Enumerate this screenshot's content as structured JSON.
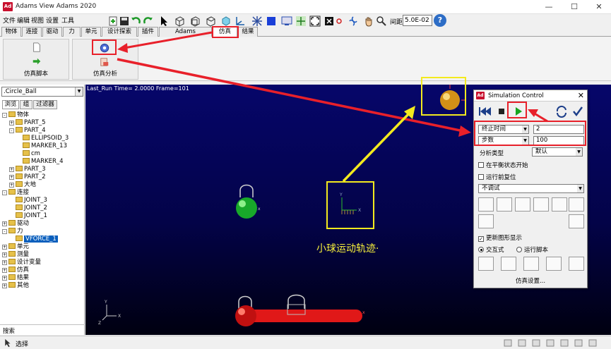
{
  "window": {
    "title": "Adams View Adams 2020",
    "minimize": "—",
    "maximize": "☐",
    "close": "✕"
  },
  "menu": [
    "文件",
    "编辑",
    "视图",
    "设置",
    "工具"
  ],
  "toolbar": {
    "zoom_label": "间距",
    "zoom_value": "5.0E-02",
    "help": "?"
  },
  "tabs": [
    "物体",
    "连接",
    "驱动",
    "力",
    "单元",
    "设计探索",
    "插件",
    "Adams Machinery",
    "仿真",
    "结果"
  ],
  "ribbon": {
    "group1_label": "仿真脚本",
    "group2_label": "仿真分析"
  },
  "browser": {
    "model": ".Circle_Ball",
    "subtabs": [
      "浏览",
      "组",
      "过滤器"
    ],
    "tree": [
      {
        "label": "物体",
        "indent": 0,
        "expand": "-"
      },
      {
        "label": "PART_5",
        "indent": 1,
        "expand": "+"
      },
      {
        "label": "PART_4",
        "indent": 1,
        "expand": "-"
      },
      {
        "label": "ELLIPSOID_3",
        "indent": 2,
        "expand": ""
      },
      {
        "label": "MARKER_13",
        "indent": 2,
        "expand": ""
      },
      {
        "label": "cm",
        "indent": 2,
        "expand": ""
      },
      {
        "label": "MARKER_4",
        "indent": 2,
        "expand": ""
      },
      {
        "label": "PART_3",
        "indent": 1,
        "expand": "+"
      },
      {
        "label": "PART_2",
        "indent": 1,
        "expand": "+"
      },
      {
        "label": "大地",
        "indent": 1,
        "expand": "+"
      },
      {
        "label": "连接",
        "indent": 0,
        "expand": "-"
      },
      {
        "label": "JOINT_3",
        "indent": 1,
        "expand": ""
      },
      {
        "label": "JOINT_2",
        "indent": 1,
        "expand": ""
      },
      {
        "label": "JOINT_1",
        "indent": 1,
        "expand": ""
      },
      {
        "label": "驱动",
        "indent": 0,
        "expand": "+"
      },
      {
        "label": "力",
        "indent": 0,
        "expand": "-"
      },
      {
        "label": "VFORCE_1",
        "indent": 1,
        "expand": "",
        "selected": true
      },
      {
        "label": "单元",
        "indent": 0,
        "expand": "+"
      },
      {
        "label": "测量",
        "indent": 0,
        "expand": "+"
      },
      {
        "label": "设计变量",
        "indent": 0,
        "expand": "+"
      },
      {
        "label": "仿真",
        "indent": 0,
        "expand": "+"
      },
      {
        "label": "结果",
        "indent": 0,
        "expand": "+"
      },
      {
        "label": "其他",
        "indent": 0,
        "expand": "+"
      }
    ],
    "search_label": "搜索"
  },
  "viewport": {
    "run_info": "Last_Run  Time= 2.0000  Frame=101",
    "caption": "小球运动轨迹·",
    "colors": {
      "gold_ball": "#e8a91c",
      "green_ball": "#1fbf2a",
      "red_ball": "#e01818",
      "annotation_red": "#e8202a",
      "annotation_yellow": "#f3ea1e"
    }
  },
  "sim_control": {
    "title": "Simulation Control",
    "end_type": "终止时间",
    "end_value": "2",
    "steps_type": "步数",
    "steps_value": "100",
    "analysis_label": "分析类型",
    "analysis_value": "默认",
    "equilibrium_label": "在平衡状态开始",
    "reset_label": "运行前复位",
    "debug_value": "不调试",
    "update_graphics_label": "更新图形显示",
    "interactive_label": "交互式",
    "script_label": "运行脚本",
    "settings_label": "仿真设置..."
  },
  "statusbar": {
    "text": "选择"
  }
}
